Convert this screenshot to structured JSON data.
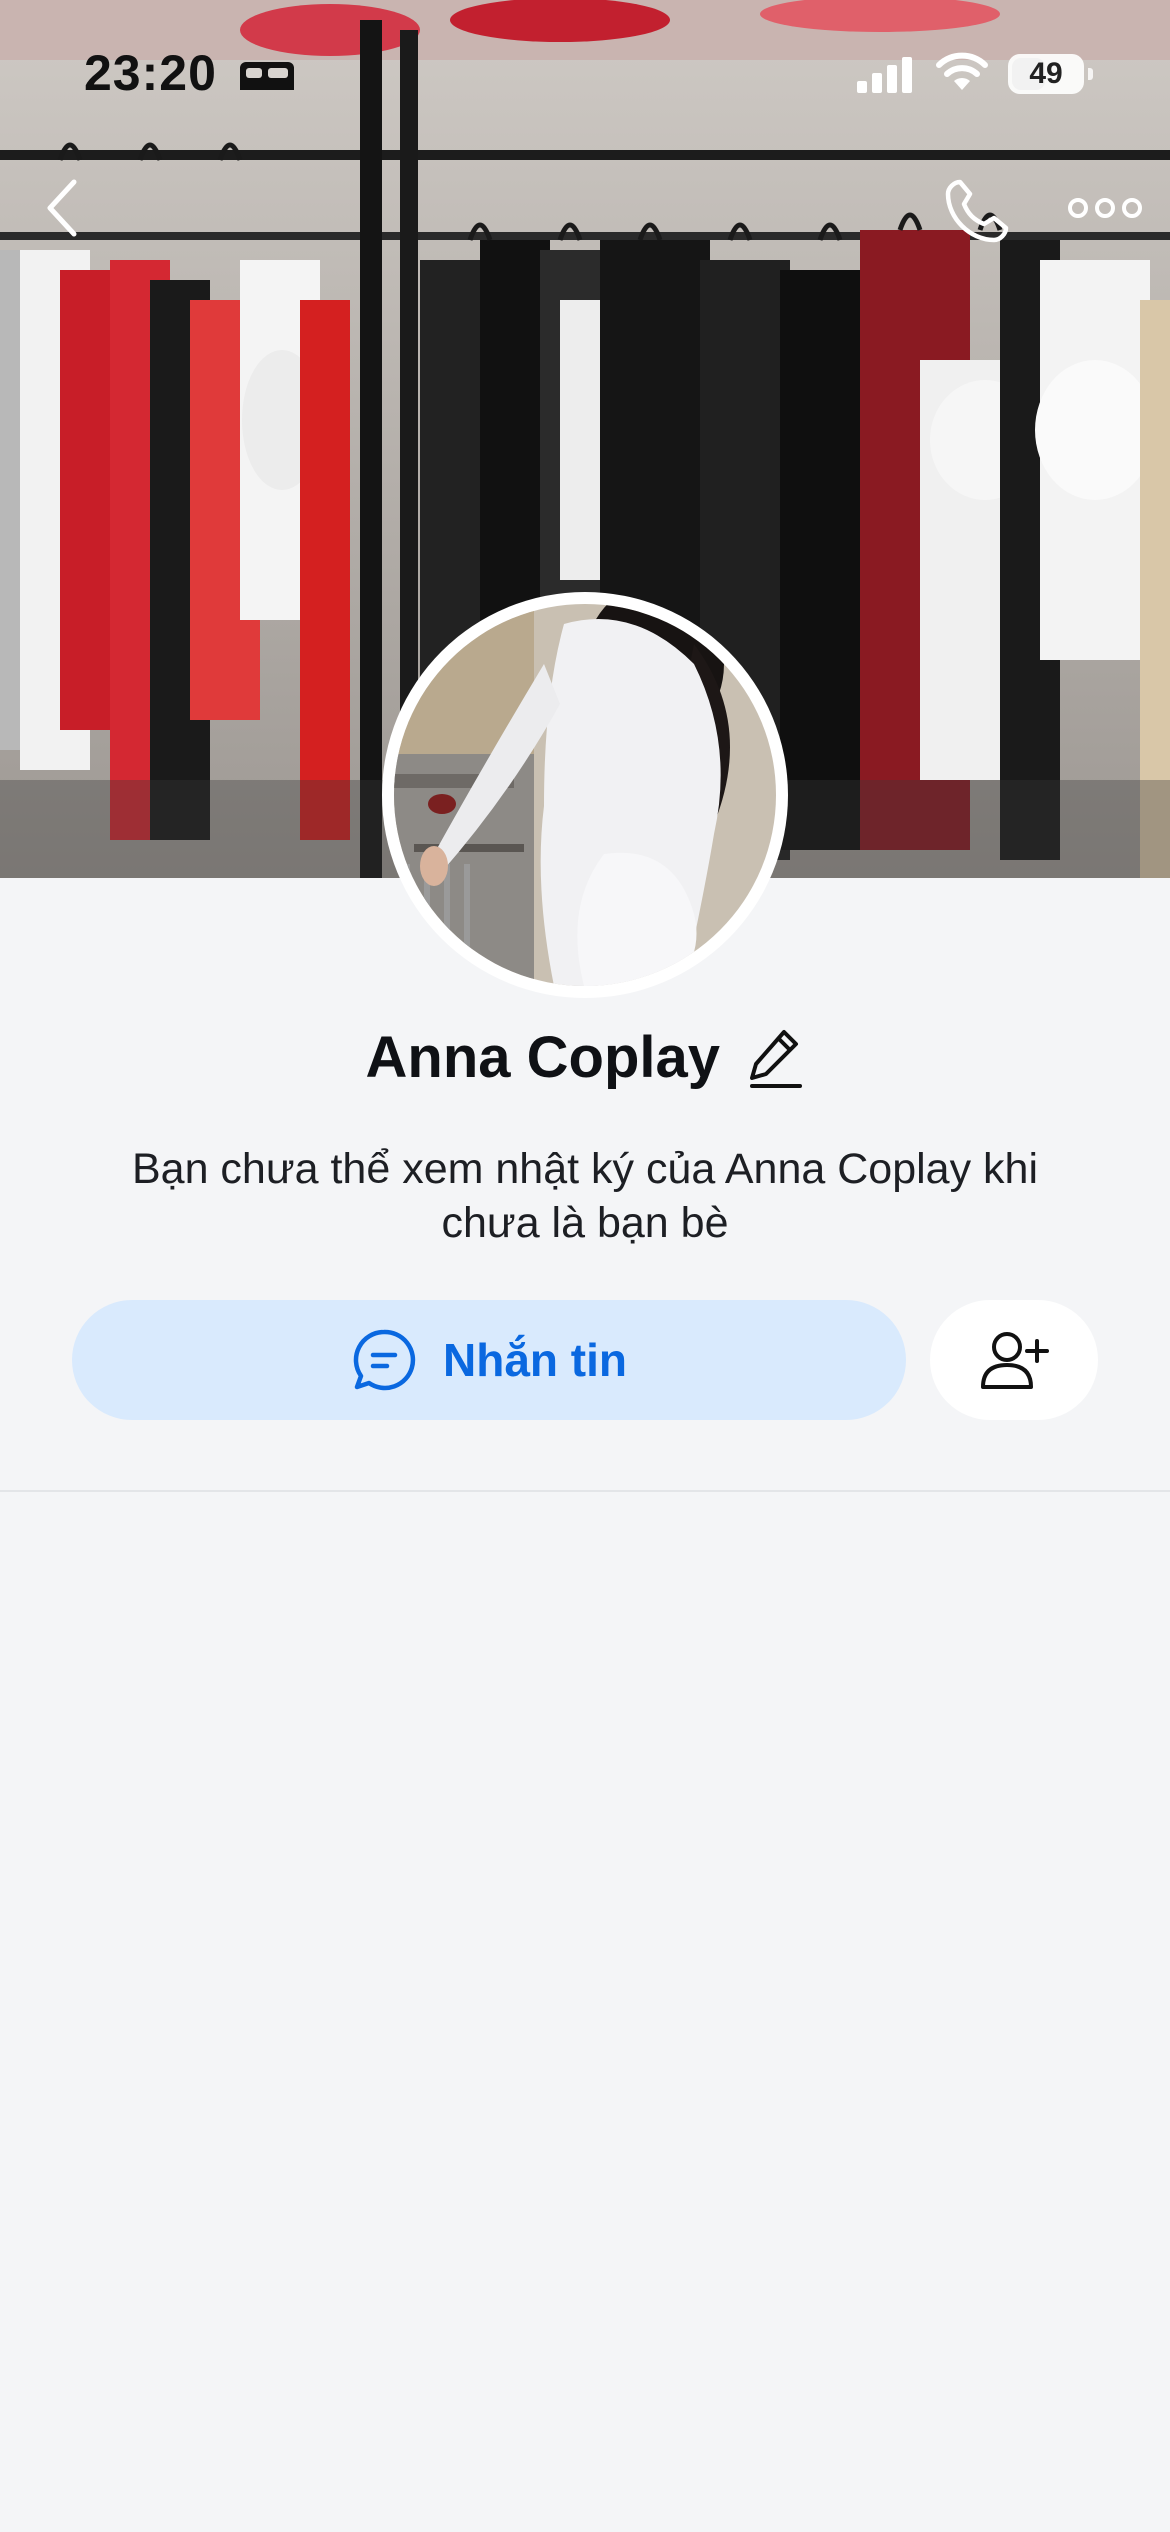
{
  "status_bar": {
    "time": "23:20",
    "battery_percent": 49,
    "battery_label": "49",
    "icons": [
      "sleep-mode-icon",
      "cellular-signal-icon",
      "wifi-icon",
      "battery-icon"
    ]
  },
  "header": {
    "back_icon": "chevron-left-icon",
    "call_icon": "phone-icon",
    "more_icon": "ellipsis-icon"
  },
  "profile": {
    "name": "Anna Coplay",
    "edit_icon": "pencil-icon",
    "privacy_note": "Bạn chưa thể xem nhật ký của Anna Coplay khi chưa là bạn bè"
  },
  "actions": {
    "message_label": "Nhắn tin",
    "message_icon": "chat-bubble-icon",
    "add_friend_icon": "add-friend-icon"
  },
  "colors": {
    "accent": "#0a68e0",
    "message_button_bg": "#d9eafd",
    "page_bg": "#f4f5f7"
  }
}
